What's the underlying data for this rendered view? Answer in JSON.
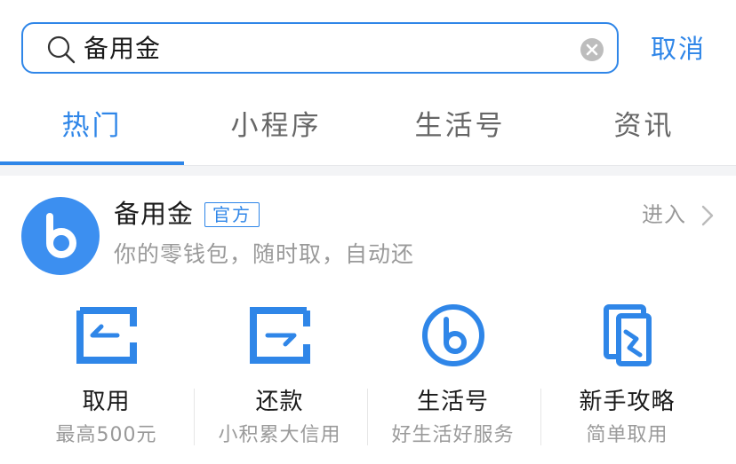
{
  "search": {
    "query": "备用金",
    "cancel_label": "取消"
  },
  "tabs": [
    {
      "label": "热门",
      "active": true
    },
    {
      "label": "小程序",
      "active": false
    },
    {
      "label": "生活号",
      "active": false
    },
    {
      "label": "资讯",
      "active": false
    }
  ],
  "result": {
    "name": "备用金",
    "badge": "官方",
    "description": "你的零钱包，随时取，自动还",
    "enter_label": "进入",
    "services": [
      {
        "title": "取用",
        "subtitle": "最高500元",
        "icon": "withdraw-icon"
      },
      {
        "title": "还款",
        "subtitle": "小积累大信用",
        "icon": "repay-icon"
      },
      {
        "title": "生活号",
        "subtitle": "好生活好服务",
        "icon": "life-account-icon"
      },
      {
        "title": "新手攻略",
        "subtitle": "简单取用",
        "icon": "guide-icon"
      }
    ]
  },
  "colors": {
    "accent": "#2f86e8",
    "logo": "#3c8ff0",
    "muted": "#9a9a9a"
  }
}
